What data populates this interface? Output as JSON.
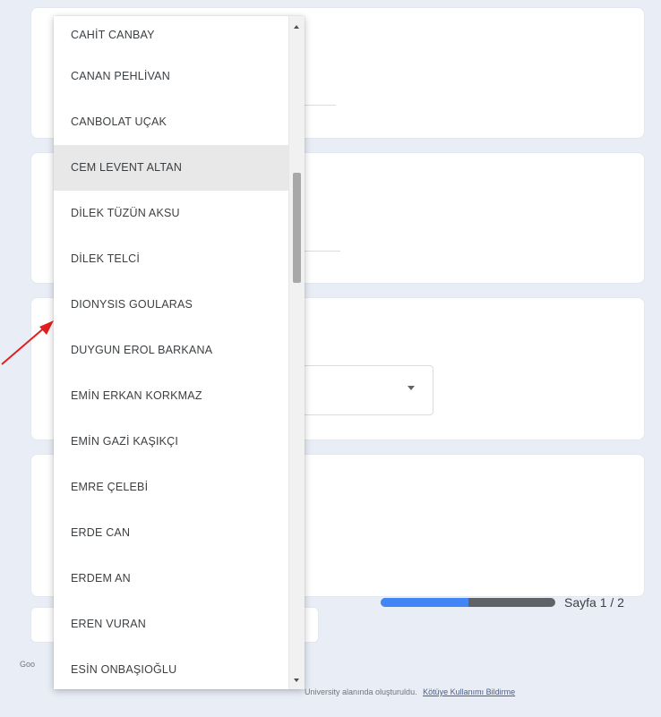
{
  "form": {
    "progress_percent": 50,
    "page_label": "Sayfa 1 / 2",
    "footer_left": "Goo",
    "footer_text": "University alanında oluşturuldu.",
    "footer_link": "Kötüye Kullanımı Bildirme"
  },
  "dropdown": {
    "items": [
      "CAHİT CANBAY",
      "CANAN PEHLİVAN",
      "CANBOLAT UÇAK",
      "CEM LEVENT ALTAN",
      "DİLEK TÜZÜN AKSU",
      "DİLEK TELCİ",
      "DIONYSIS GOULARAS",
      "DUYGUN EROL BARKANA",
      "EMİN ERKAN KORKMAZ",
      "EMİN GAZİ KAŞIKÇI",
      "EMRE ÇELEBİ",
      "ERDE CAN",
      "ERDEM AN",
      "EREN VURAN",
      "ESİN ONBAŞIOĞLU"
    ],
    "hovered_index": 3
  },
  "colors": {
    "progress_fill": "#4285f4",
    "progress_track": "#5f6368",
    "annotation_arrow": "#e02020"
  }
}
